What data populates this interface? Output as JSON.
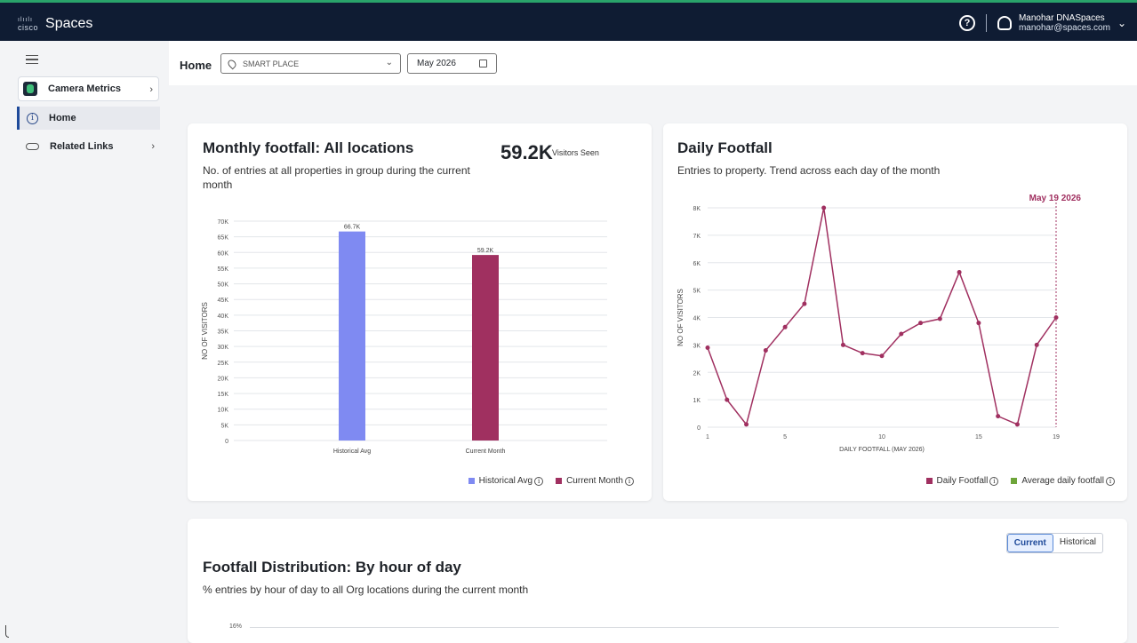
{
  "topbar": {
    "brand": "Spaces",
    "logo_text": "cisco",
    "user_line1": "Manohar DNASpaces",
    "user_line2": "manohar@spaces.com"
  },
  "sidebar": {
    "app_name": "Camera Metrics",
    "items": [
      {
        "label": "Home",
        "active": true
      },
      {
        "label": "Related Links",
        "active": false
      }
    ]
  },
  "header": {
    "breadcrumb": "Home",
    "location_value": "SMART PLACE",
    "date_value": "May 2026"
  },
  "monthly": {
    "title": "Monthly footfall: All locations",
    "subtitle": "No. of entries at all properties in group during the current month",
    "stat_value": "59.2K",
    "stat_label": "Visitors Seen",
    "legend": [
      "Historical Avg",
      "Current Month"
    ]
  },
  "daily": {
    "title": "Daily Footfall",
    "subtitle": "Entries to property. Trend across each day of the month",
    "marker_label": "May 19 2026",
    "legend": [
      "Daily Footfall",
      "Average daily footfall"
    ]
  },
  "distribution": {
    "title": "Footfall Distribution: By hour of day",
    "subtitle": "% entries by hour of day to all Org locations during the current month",
    "toggle": [
      "Current",
      "Historical"
    ],
    "first_tick": "16%"
  },
  "colors": {
    "historical": "#7f8af2",
    "current": "#a03060",
    "line": "#a03060",
    "average": "#6ea53a"
  },
  "chart_data": [
    {
      "type": "bar",
      "categories": [
        "Historical Avg",
        "Current Month"
      ],
      "values": [
        66700,
        59200
      ],
      "value_labels": [
        "66.7K",
        "59.2K"
      ],
      "ylabel": "NO OF VISITORS",
      "ylim": [
        0,
        70000
      ],
      "yticks": [
        "0",
        "5K",
        "10K",
        "15K",
        "20K",
        "25K",
        "30K",
        "35K",
        "40K",
        "45K",
        "50K",
        "55K",
        "60K",
        "65K",
        "70K"
      ],
      "legend": [
        "Historical Avg",
        "Current Month"
      ],
      "grid": true
    },
    {
      "type": "line",
      "x": [
        1,
        2,
        3,
        4,
        5,
        6,
        7,
        8,
        9,
        10,
        11,
        12,
        13,
        14,
        15,
        16,
        17,
        18,
        19
      ],
      "series": [
        {
          "name": "Daily Footfall",
          "values": [
            2900,
            1000,
            100,
            2800,
            3650,
            4500,
            8000,
            3000,
            2700,
            2600,
            3400,
            3800,
            3950,
            5650,
            3800,
            400,
            100,
            3000,
            4000
          ]
        }
      ],
      "xlabel": "DAILY FOOTFALL (MAY 2026)",
      "ylabel": "NO OF VISITORS",
      "ylim": [
        0,
        8000
      ],
      "yticks": [
        "0",
        "1K",
        "2K",
        "3K",
        "4K",
        "5K",
        "6K",
        "7K",
        "8K"
      ],
      "xticks": [
        1,
        5,
        10,
        15,
        19
      ],
      "marker": {
        "x": 19,
        "label": "May 19 2026"
      },
      "grid": true
    }
  ]
}
